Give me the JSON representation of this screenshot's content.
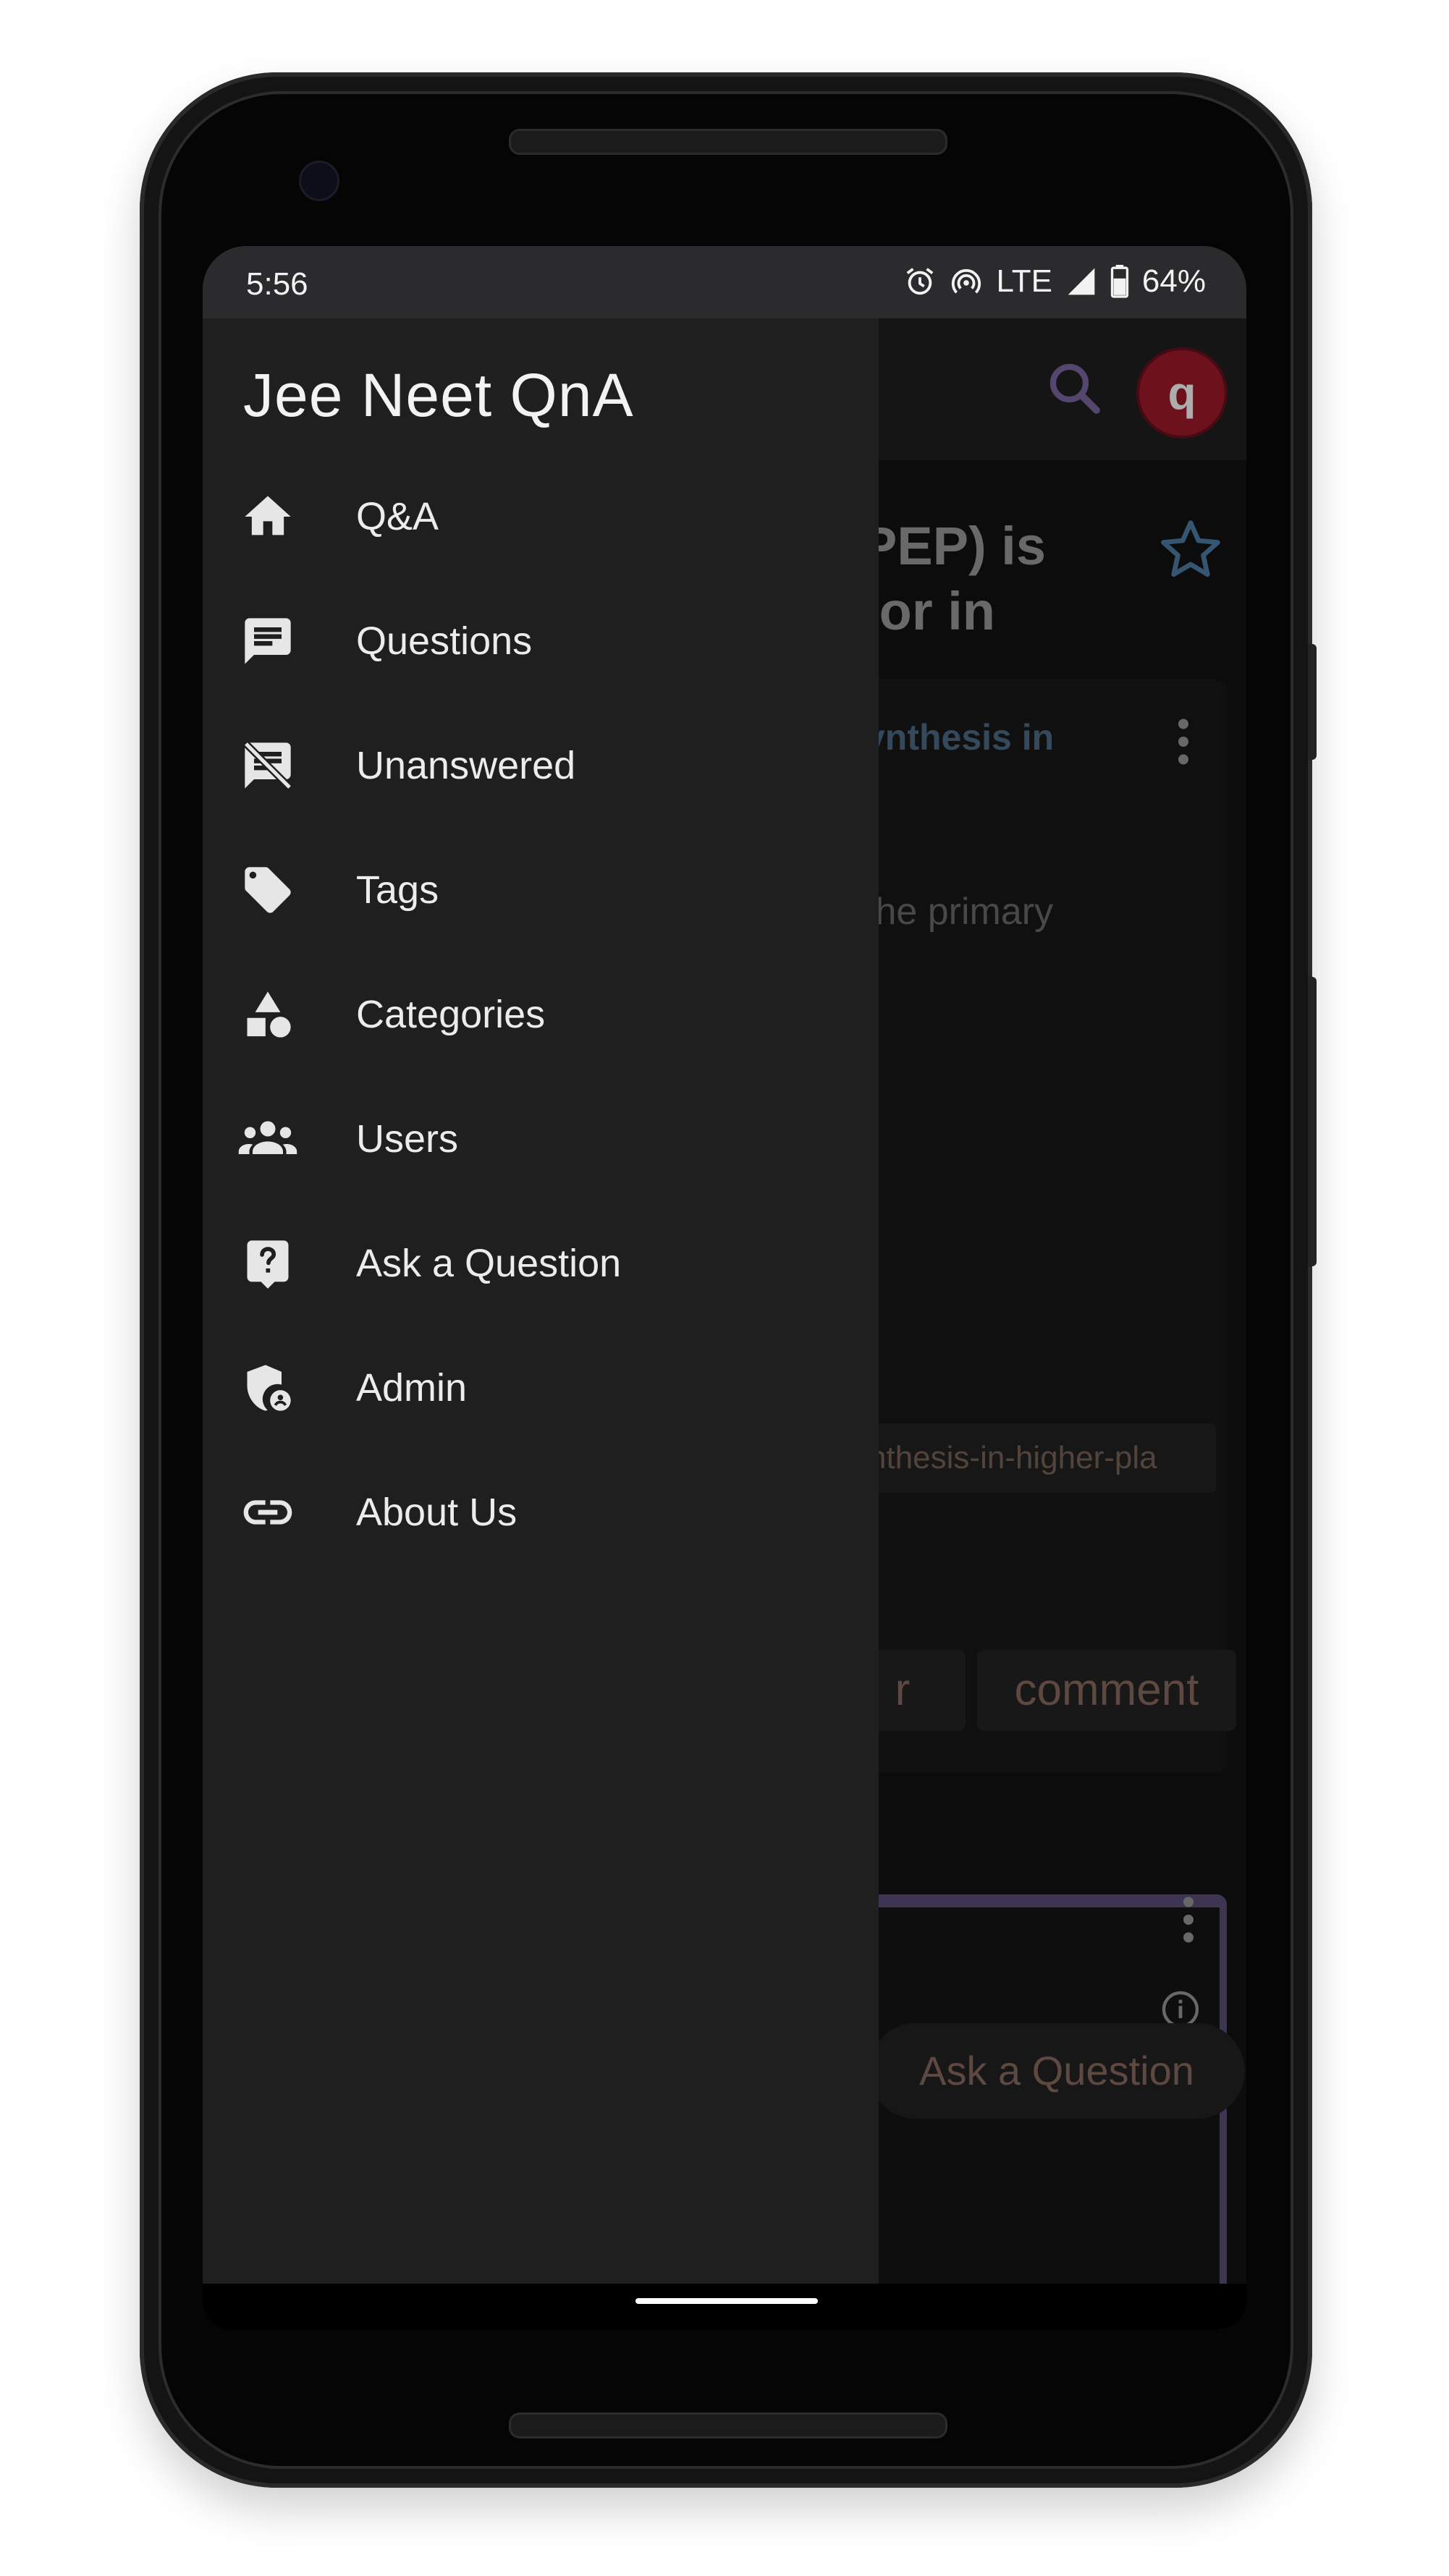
{
  "status_bar": {
    "time": "5:56",
    "network": "LTE",
    "battery": "64%"
  },
  "background_page": {
    "title_line1": "PEP) is",
    "title_line2": "tor in",
    "link_fragment": "ynthesis in",
    "text_fragment": "the primary",
    "tag_fragment": "nthesis-in-higher-pla",
    "btn_fragment": "r",
    "comment_button": "comment",
    "ask_question_button": "Ask a Question",
    "avatar_letter": "q"
  },
  "drawer": {
    "title": "Jee Neet QnA",
    "items": [
      {
        "label": "Q&A",
        "icon": "home-icon"
      },
      {
        "label": "Questions",
        "icon": "chat-icon"
      },
      {
        "label": "Unanswered",
        "icon": "chat-off-icon"
      },
      {
        "label": "Tags",
        "icon": "tag-icon"
      },
      {
        "label": "Categories",
        "icon": "shapes-icon"
      },
      {
        "label": "Users",
        "icon": "people-icon"
      },
      {
        "label": "Ask a Question",
        "icon": "help-icon"
      },
      {
        "label": "Admin",
        "icon": "admin-shield-icon"
      },
      {
        "label": "About Us",
        "icon": "link-icon"
      }
    ]
  },
  "colors": {
    "drawer_bg": "#1f1f1f",
    "accent_purple": "#7e67a6",
    "star_blue": "#4f7ea6",
    "avatar_red": "#a11a2a"
  }
}
